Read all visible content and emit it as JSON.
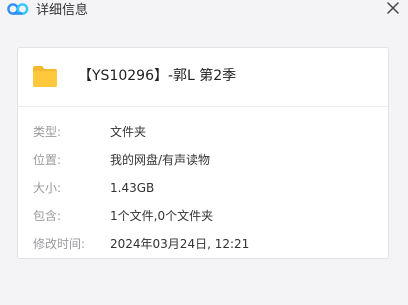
{
  "window": {
    "title": "详细信息",
    "close_glyph": "✕"
  },
  "file": {
    "name": "【YS10296】-郭L 第2季",
    "icon": "folder-icon"
  },
  "details": [
    {
      "label": "类型:",
      "value": "文件夹"
    },
    {
      "label": "位置:",
      "value": "我的网盘/有声读物"
    },
    {
      "label": "大小:",
      "value": "1.43GB"
    },
    {
      "label": "包含:",
      "value": "1个文件,0个文件夹"
    },
    {
      "label": "修改时间:",
      "value": "2024年03月24日, 12:21"
    }
  ],
  "colors": {
    "logo_blue": "#2f8ff7",
    "logo_cyan": "#32c7ff",
    "folder_yellow": "#ffc83d",
    "folder_dark": "#f5b82e"
  }
}
